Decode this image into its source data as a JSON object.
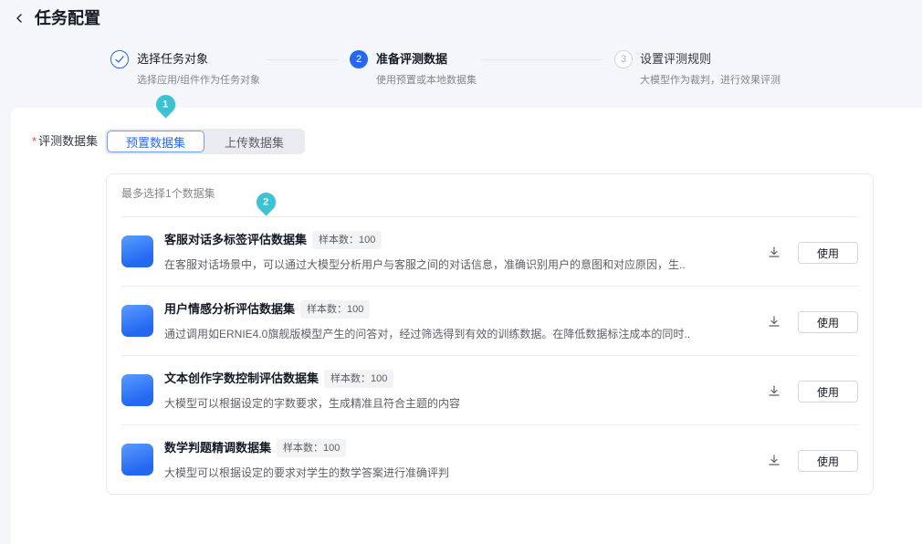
{
  "header": {
    "back_icon": "chevron-left-icon",
    "title": "任务配置"
  },
  "steps": [
    {
      "completed": true,
      "icon": "check-icon",
      "label": "选择任务对象",
      "desc": "选择应用/组件作为任务对象"
    },
    {
      "current": true,
      "index": "2",
      "label": "准备评测数据",
      "desc": "使用预置或本地数据集"
    },
    {
      "current": false,
      "index": "3",
      "label": "设置评测规则",
      "desc": "大模型作为裁判，进行效果评测"
    }
  ],
  "form": {
    "required_mark": "*",
    "label": "评测数据集",
    "segments": [
      {
        "label": "预置数据集",
        "selected": true
      },
      {
        "label": "上传数据集",
        "selected": false
      }
    ]
  },
  "dataset_panel": {
    "hint": "最多选择1个数据集",
    "items": [
      {
        "icon": "dataset-icon",
        "title": "客服对话多标签评估数据集",
        "tag": "样本数：100",
        "desc": "在客服对话场景中，可以通过大模型分析用户与客服之间的对话信息，准确识别用户的意图和对应原因，生..",
        "download_icon": "download-icon",
        "action": "使用"
      },
      {
        "icon": "dataset-icon",
        "title": "用户情感分析评估数据集",
        "tag": "样本数：100",
        "desc": "通过调用如ERNIE4.0旗舰版模型产生的问答对，经过筛选得到有效的训练数据。在降低数据标注成本的同时..",
        "download_icon": "download-icon",
        "action": "使用"
      },
      {
        "icon": "dataset-icon",
        "title": "文本创作字数控制评估数据集",
        "tag": "样本数：100",
        "desc": "大模型可以根据设定的字数要求，生成精准且符合主题的内容",
        "download_icon": "download-icon",
        "action": "使用"
      },
      {
        "icon": "dataset-icon",
        "title": "数学判题精调数据集",
        "tag": "样本数：100",
        "desc": "大模型可以根据设定的要求对学生的数学答案进行准确评判",
        "download_icon": "download-icon",
        "action": "使用"
      }
    ]
  },
  "annotations": {
    "markers": [
      {
        "label": "1"
      },
      {
        "label": "2"
      }
    ]
  },
  "colors": {
    "primary": "#2468f2",
    "required": "#e8453c",
    "marker": "#3cc3d3",
    "page_bg": "#f5f6f9"
  }
}
